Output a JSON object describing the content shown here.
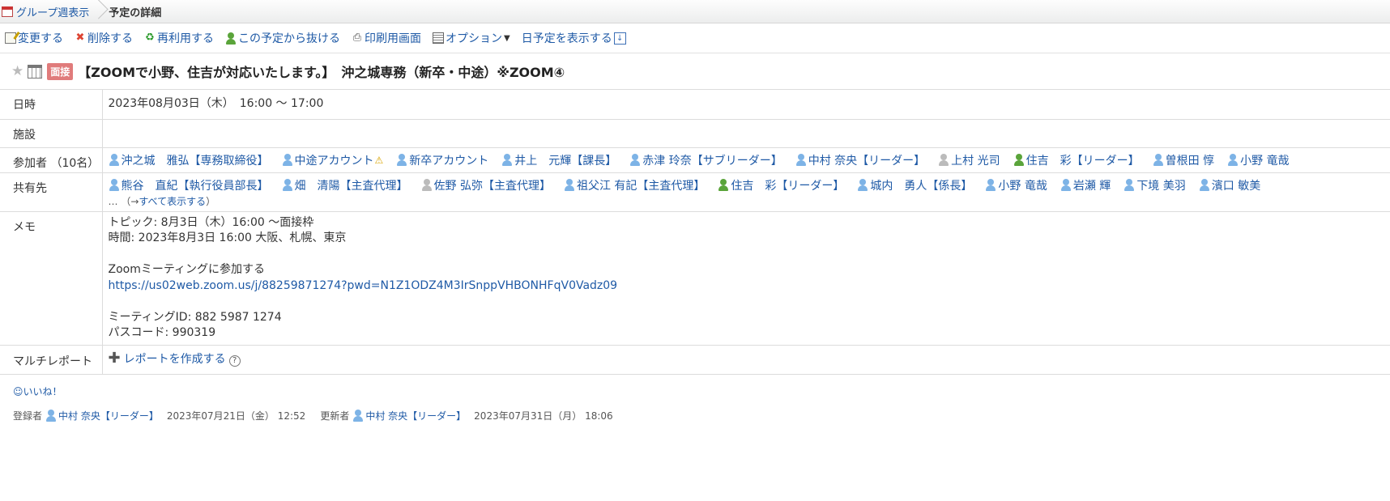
{
  "breadcrumb": {
    "parent": "グループ週表示",
    "current": "予定の詳細"
  },
  "toolbar": {
    "edit": "変更する",
    "delete": "削除する",
    "reuse": "再利用する",
    "leave": "この予定から抜ける",
    "print": "印刷用画面",
    "options": "オプション",
    "show_day": "日予定を表示する"
  },
  "event": {
    "badge": "面接",
    "title": "【ZOOMで小野、住吉が対応いたします。】　沖之城専務（新卒・中途）※ZOOM④"
  },
  "labels": {
    "datetime": "日時",
    "facility": "施設",
    "participants": "参加者 （10名）",
    "shared": "共有先",
    "memo": "メモ",
    "multireport": "マルチレポート"
  },
  "datetime": "2023年08月03日（木）　16:00 ～ 17:00",
  "facility": "",
  "participants": [
    {
      "name": "沖之城　雅弘【専務取締役】",
      "icon": "user"
    },
    {
      "name": "中途アカウント",
      "icon": "user",
      "warn": true
    },
    {
      "name": "新卒アカウント",
      "icon": "user"
    },
    {
      "name": "井上　元輝【課長】",
      "icon": "user"
    },
    {
      "name": "赤津 玲奈【サブリーダー】",
      "icon": "user"
    },
    {
      "name": "中村 奈央【リーダー】",
      "icon": "user"
    },
    {
      "name": "上村 光司",
      "icon": "inactive"
    },
    {
      "name": "住吉　彩【リーダー】",
      "icon": "green"
    },
    {
      "name": "曽根田 惇",
      "icon": "user"
    },
    {
      "name": "小野 竜哉",
      "icon": "user"
    }
  ],
  "shared": [
    {
      "name": "熊谷　直紀【執行役員部長】",
      "icon": "user"
    },
    {
      "name": "畑　清陽【主査代理】",
      "icon": "user"
    },
    {
      "name": "佐野 弘弥【主査代理】",
      "icon": "inactive"
    },
    {
      "name": "祖父江 有記【主査代理】",
      "icon": "user"
    },
    {
      "name": "住吉　彩【リーダー】",
      "icon": "green"
    },
    {
      "name": "城内　勇人【係長】",
      "icon": "user"
    },
    {
      "name": "小野 竜哉",
      "icon": "user"
    },
    {
      "name": "岩瀬 輝",
      "icon": "user"
    },
    {
      "name": "下境 美羽",
      "icon": "user"
    },
    {
      "name": "濱口 敏美",
      "icon": "user"
    }
  ],
  "shared_more": {
    "ellipsis": "…",
    "open": "（→",
    "link": "すべて表示する",
    "close": "）"
  },
  "memo": {
    "topic": "トピック: 8月3日（木）16:00 ～面接枠",
    "time": "時間: 2023年8月3日 16:00 大阪、札幌、東京",
    "join_label": "Zoomミーティングに参加する",
    "url": "https://us02web.zoom.us/j/88259871274?pwd=N1Z1ODZ4M3IrSnppVHBONHFqV0Vadz09",
    "meeting_id": "ミーティングID: 882 5987 1274",
    "passcode": "パスコード: 990319"
  },
  "multireport": {
    "create": "レポートを作成する",
    "help": "?"
  },
  "like": "いいね！",
  "footer": {
    "registered_label": "登録者",
    "registered_by": "中村 奈央【リーダー】",
    "registered_at": "2023年07月21日（金） 12:52",
    "updated_label": "更新者",
    "updated_by": "中村 奈央【リーダー】",
    "updated_at": "2023年07月31日（月） 18:06"
  }
}
